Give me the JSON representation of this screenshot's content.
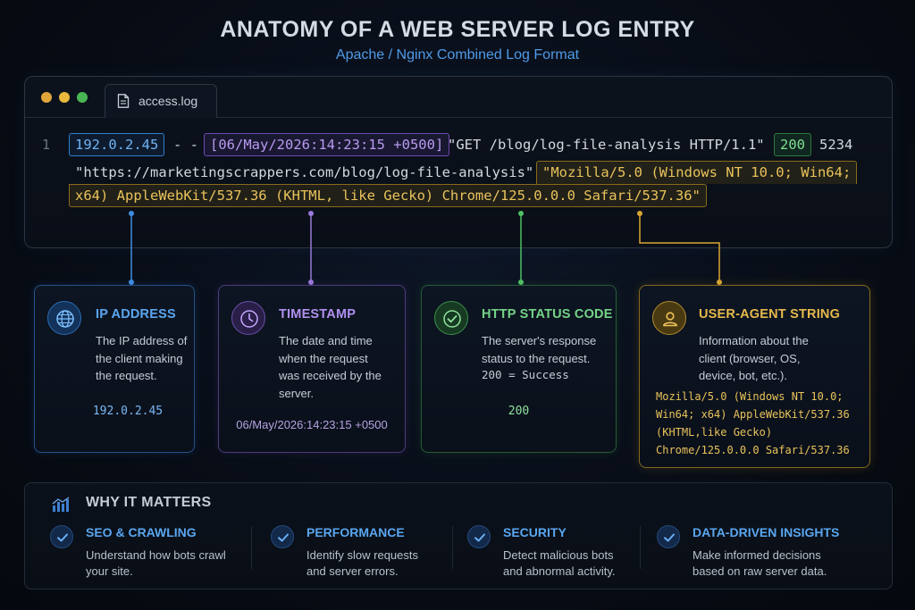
{
  "header": {
    "title": "ANATOMY OF A WEB SERVER LOG ENTRY",
    "subtitle": "Apache / Nginx Combined Log Format"
  },
  "window": {
    "tab_label": "access.log",
    "line_number": "1",
    "ip": "192.0.2.45",
    "separator": "- -",
    "timestamp": "[06/May/2026:14:23:15 +0500]",
    "request": "\"GET /blog/log-file-analysis HTTP/1.1\"",
    "status": "200",
    "bytes": "5234",
    "referrer": "\"https://marketingscrappers.com/blog/log-file-analysis\"",
    "user_agent_part1": "\"Mozilla/5.0 (Windows NT 10.0; Win64;",
    "user_agent_part2": "x64) AppleWebKit/537.36 (KHTML, like Gecko) Chrome/125.0.0.0 Safari/537.36\""
  },
  "cards": [
    {
      "title": "IP ADDRESS",
      "description": "The IP address of the client making the request.",
      "value": "192.0.2.45",
      "icon": "globe-icon",
      "color": "#5aa6f0"
    },
    {
      "title": "TIMESTAMP",
      "description": "The date and time when the request was received by the server.",
      "value": "06/May/2026:14:23:15 +0500",
      "icon": "clock-icon",
      "color": "#b190ef"
    },
    {
      "title": "HTTP STATUS CODE",
      "description": "The server's response status to the request.",
      "code": "200 = Success",
      "value": "200",
      "icon": "check-circle-icon",
      "color": "#74d486"
    },
    {
      "title": "USER-AGENT STRING",
      "description": "Information about the client (browser, OS, device, bot, etc.).",
      "value": "Mozilla/5.0 (Windows NT 10.0; Win64; x64) AppleWebKit/537.36 (KHTML,like Gecko) Chrome/125.0.0.0 Safari/537.36",
      "icon": "user-icon",
      "color": "#e6b94c"
    }
  ],
  "why": {
    "title": "WHY IT MATTERS",
    "icon": "bar-chart-icon",
    "items": [
      {
        "title": "SEO & CRAWLING",
        "line1": "Understand how bots crawl",
        "line2": "your site."
      },
      {
        "title": "PERFORMANCE",
        "line1": "Identify slow requests",
        "line2": "and server errors."
      },
      {
        "title": "SECURITY",
        "line1": "Detect malicious bots",
        "line2": "and abnormal activity."
      },
      {
        "title": "DATA-DRIVEN INSIGHTS",
        "line1": "Make informed decisions",
        "line2": "based on raw server data."
      }
    ]
  }
}
